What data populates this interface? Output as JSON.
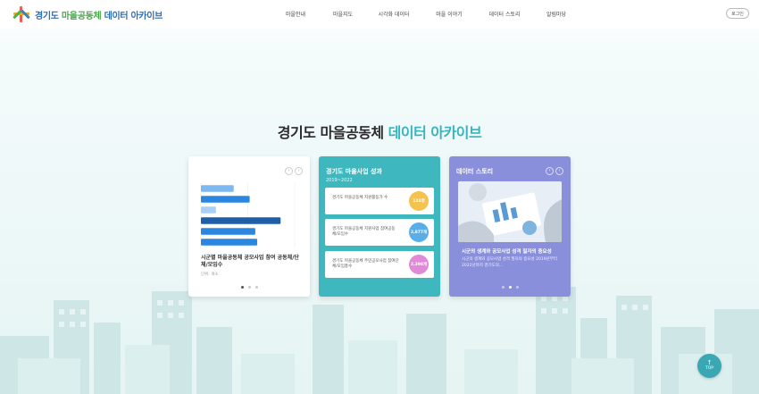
{
  "header": {
    "logo_part1": "경기도",
    "logo_part2": "마을공동체",
    "logo_part3": "데이터 아카이브",
    "nav": [
      "마을안내",
      "마을지도",
      "시각화 데이터",
      "마을 이야기",
      "데이터 스토리",
      "알림마당"
    ],
    "login": "로그인"
  },
  "hero": {
    "title_main": "경기도 마을공동체",
    "title_accent": "데이터 아카이브"
  },
  "card1": {
    "title": "시군별 마을공동체 공모사업 참여 공동체/단체/모임수",
    "unit": "단위: 개소",
    "pager_prev": "‹",
    "pager_next": "›"
  },
  "chart_data": {
    "type": "bar",
    "orientation": "horizontal",
    "title": "시군별 마을공동체 공모사업 참여 공동체/단체/모임수",
    "unit": "단위: 개소",
    "categories": [],
    "values": [
      0.35,
      0.52,
      0.16,
      0.85,
      0.58,
      0.6
    ],
    "colors": [
      "#7db8f0",
      "#2b86e0",
      "#a9d0f5",
      "#1f5ea8",
      "#2b86e0",
      "#2b86e0"
    ]
  },
  "card2": {
    "title": "경기도 마을사업 성과",
    "period": "2019~2022",
    "stats": [
      {
        "label": "경기도 마을공동체 지원활동가 수",
        "value": "124명",
        "color": "#f4c24d"
      },
      {
        "label": "경기도 마을공동체 지원사업 참여공동체/모임수",
        "value": "2,877개",
        "color": "#5aaee8"
      },
      {
        "label": "경기도 마을공동체 주민공모사업 참여단체/모임총수",
        "value": "2,398개",
        "color": "#e08ad8"
      }
    ]
  },
  "card3": {
    "title": "데이터 스토리",
    "story_title": "시군의 생계와 공모사업 성격 필자의 중요성",
    "story_desc": "시군의 생계와 공모사업 성격 필자의 중요성 2019년부터 2022년까지 경기도의...",
    "pager_prev": "‹",
    "pager_next": "›"
  },
  "top_button": {
    "arrow": "↑",
    "label": "TOP"
  },
  "colors": {
    "accent": "#39b3be",
    "card2_bg": "#3fb7be",
    "card3_bg": "#8a8fdc"
  }
}
